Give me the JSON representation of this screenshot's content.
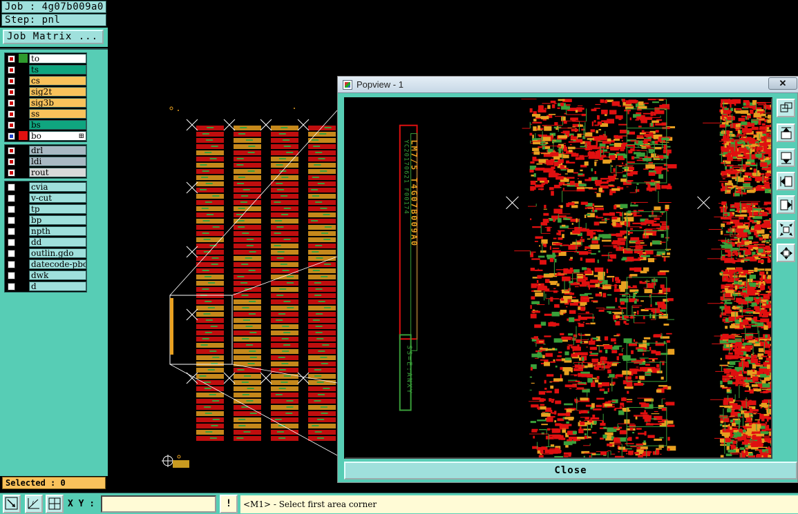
{
  "job": {
    "label": "Job : 4g07b009a0"
  },
  "step": {
    "label": "Step: pnl"
  },
  "job_matrix_button": "Job Matrix ...",
  "layers": {
    "board": [
      {
        "name": "to",
        "color": "#ffffff",
        "swatch": "#2e9b2e",
        "mark": "#cc0000"
      },
      {
        "name": "ts",
        "color": "#0fa57f",
        "swatch": "#000000",
        "mark": "#cc0000"
      },
      {
        "name": "cs",
        "color": "#f9c25b",
        "swatch": "#000000",
        "mark": "#cc0000"
      },
      {
        "name": "sig2t",
        "color": "#f9c25b",
        "swatch": "#000000",
        "mark": "#cc0000"
      },
      {
        "name": "sig3b",
        "color": "#f9c25b",
        "swatch": "#000000",
        "mark": "#cc0000"
      },
      {
        "name": "ss",
        "color": "#f9c25b",
        "swatch": "#000000",
        "mark": "#cc0000"
      },
      {
        "name": "bs",
        "color": "#0fa57f",
        "swatch": "#000000",
        "mark": "#cc0000"
      },
      {
        "name": "bo",
        "color": "#ffffff",
        "swatch": "#e01010",
        "mark": "#1a3fcc",
        "plus": "⊞"
      }
    ],
    "drill": [
      {
        "name": "drl",
        "color": "#a9b9c3",
        "swatch": "#000000",
        "mark": "#cc0000"
      },
      {
        "name": "ldi",
        "color": "#a9b9c3",
        "swatch": "#000000",
        "mark": "#cc0000"
      },
      {
        "name": "rout",
        "color": "#d9d9d9",
        "swatch": "#000000",
        "mark": "#cc0000"
      }
    ],
    "misc": [
      {
        "name": "cvia",
        "color": "#9fe0dc",
        "swatch": "#000000",
        "mark": ""
      },
      {
        "name": "v-cut",
        "color": "#9fe0dc",
        "swatch": "#000000",
        "mark": ""
      },
      {
        "name": "tp",
        "color": "#9fe0dc",
        "swatch": "#000000",
        "mark": ""
      },
      {
        "name": "bp",
        "color": "#9fe0dc",
        "swatch": "#000000",
        "mark": ""
      },
      {
        "name": "npth",
        "color": "#9fe0dc",
        "swatch": "#000000",
        "mark": ""
      },
      {
        "name": "dd",
        "color": "#9fe0dc",
        "swatch": "#000000",
        "mark": ""
      },
      {
        "name": "outlin.gdo",
        "color": "#9fe0dc",
        "swatch": "#000000",
        "mark": ""
      },
      {
        "name": "datecode-pbo",
        "color": "#9fe0dc",
        "swatch": "#000000",
        "mark": ""
      },
      {
        "name": "dwk",
        "color": "#9fe0dc",
        "swatch": "#000000",
        "mark": ""
      },
      {
        "name": "d",
        "color": "#9fe0dc",
        "swatch": "#000000",
        "mark": ""
      }
    ]
  },
  "selected": "Selected : 0",
  "toolbar": {
    "xy_label": "X Y :",
    "xy_value": "",
    "warn": "!",
    "status": "<M1> - Select first area corner"
  },
  "popview": {
    "title": "Popview - 1",
    "close_x": "✕",
    "close_button": "Close",
    "vertical_text": [
      "LM7/5 T4G07B009A0",
      "YC20170621 F00174"
    ]
  },
  "colors": {
    "panel": "#57cdb5",
    "panel_light": "#9fe0dc",
    "trace_red": "#e01010",
    "trace_green": "#3aa03a",
    "trace_orange": "#e8a020"
  }
}
